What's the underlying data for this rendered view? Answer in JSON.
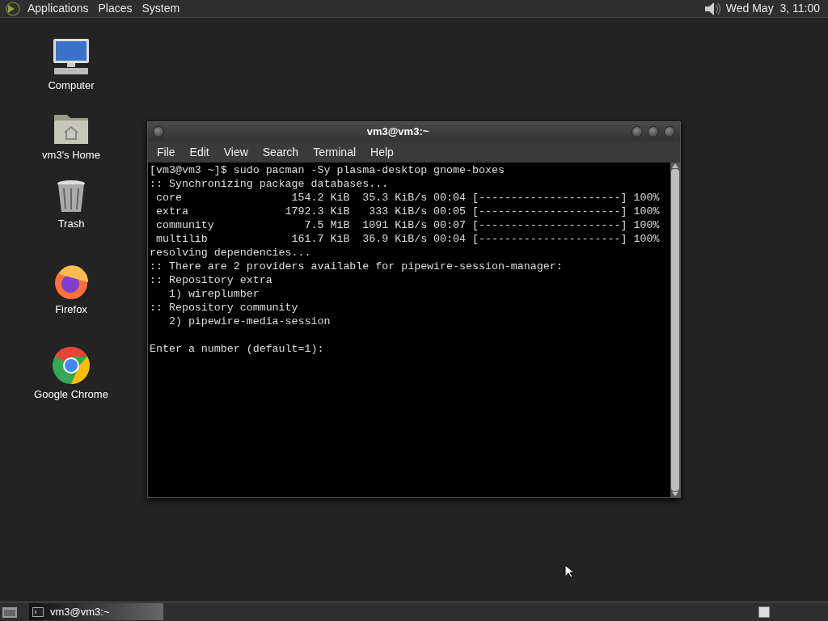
{
  "top_panel": {
    "menus": [
      "Applications",
      "Places",
      "System"
    ],
    "clock": "Wed May  3, 11:00"
  },
  "desktop_icons": [
    {
      "kind": "computer",
      "label": "Computer"
    },
    {
      "kind": "home",
      "label": "vm3's Home"
    },
    {
      "kind": "trash",
      "label": "Trash"
    },
    {
      "kind": "firefox",
      "label": "Firefox"
    },
    {
      "kind": "chrome",
      "label": "Google Chrome"
    }
  ],
  "terminal": {
    "title": "vm3@vm3:~",
    "menus": [
      "File",
      "Edit",
      "View",
      "Search",
      "Terminal",
      "Help"
    ],
    "lines": [
      "[vm3@vm3 ~]$ sudo pacman -Sy plasma-desktop gnome-boxes",
      ":: Synchronizing package databases...",
      " core                 154.2 KiB  35.3 KiB/s 00:04 [----------------------] 100%",
      " extra               1792.3 KiB   333 KiB/s 00:05 [----------------------] 100%",
      " community              7.5 MiB  1091 KiB/s 00:07 [----------------------] 100%",
      " multilib             161.7 KiB  36.9 KiB/s 00:04 [----------------------] 100%",
      "resolving dependencies...",
      ":: There are 2 providers available for pipewire-session-manager:",
      ":: Repository extra",
      "   1) wireplumber",
      ":: Repository community",
      "   2) pipewire-media-session"
    ],
    "prompt": "Enter a number (default=1):"
  },
  "taskbar": {
    "windows": [
      {
        "title": "vm3@vm3:~",
        "selected": true
      }
    ]
  }
}
